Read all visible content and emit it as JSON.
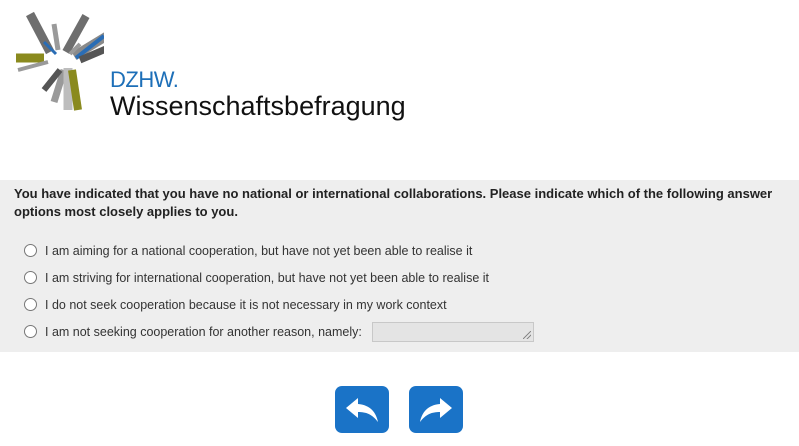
{
  "header": {
    "brand": "DZHW.",
    "tagline": "Wissenschaftsbefragung"
  },
  "survey": {
    "question": "You have indicated that you have no national or international collaborations. Please indicate which of the following answer options most closely applies to you.",
    "options": [
      "I am aiming for a national cooperation, but have not yet been able to realise it",
      "I am striving for international cooperation, but have not yet been able to realise it",
      "I do not seek cooperation because it is not necessary in my work context",
      "I am not seeking cooperation for another reason, namely:"
    ],
    "other_value": ""
  },
  "nav": {
    "back_icon": "back-arrow-icon",
    "forward_icon": "forward-arrow-icon"
  },
  "colors": {
    "accent": "#1a73c7",
    "brand_blue": "#1d6fb8",
    "panel_bg": "#eeeeee"
  }
}
